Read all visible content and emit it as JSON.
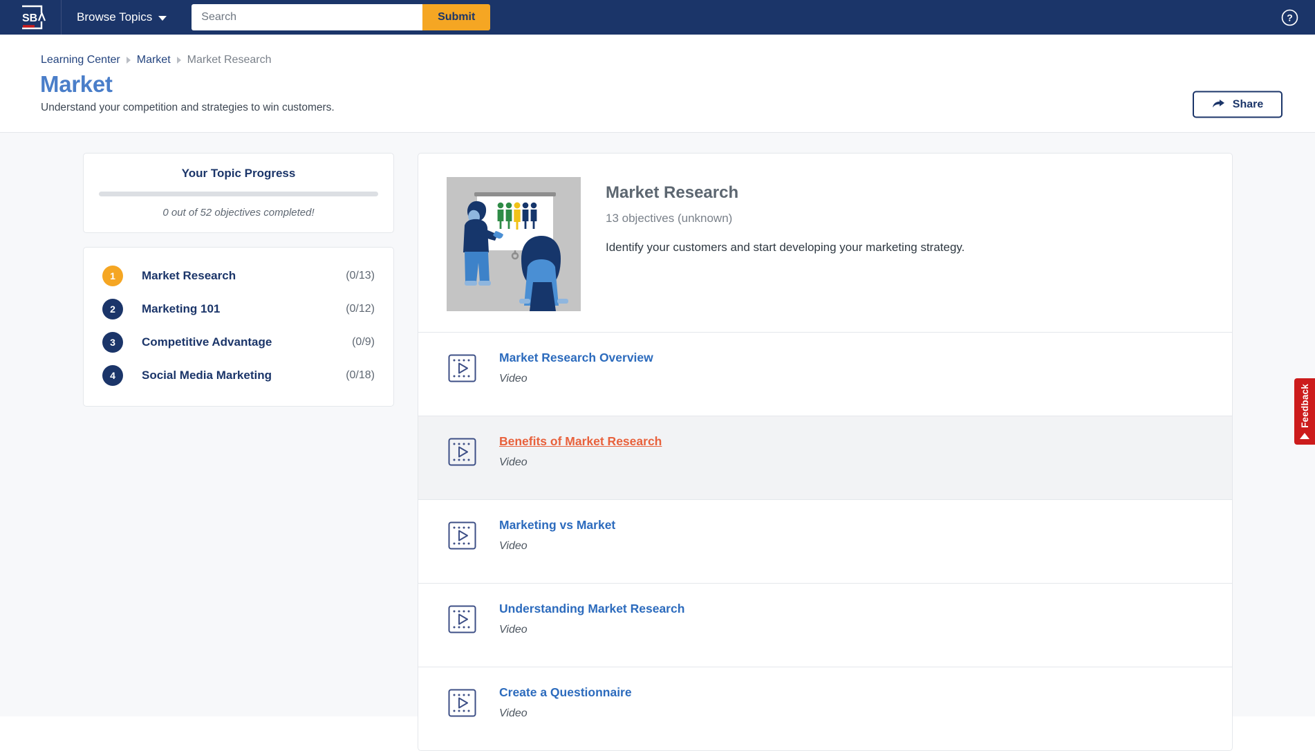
{
  "topbar": {
    "logo_text": "SBA",
    "browse_label": "Browse Topics",
    "search_placeholder": "Search",
    "search_value": "",
    "submit_label": "Submit",
    "help_icon": "question-circle-icon",
    "background_color": "#1b3569",
    "submit_color": "#f5a623"
  },
  "pagehead": {
    "breadcrumb": [
      {
        "label": "Learning Center",
        "current": false
      },
      {
        "label": "Market",
        "current": false
      },
      {
        "label": "Market Research",
        "current": true
      }
    ],
    "title": "Market",
    "subtitle": "Understand your competition and strategies to win customers.",
    "share_label": "Share",
    "share_icon": "share-arrow-icon",
    "title_color": "#4a7ec9"
  },
  "progress": {
    "title": "Your Topic Progress",
    "percent": 0,
    "note": "0 out of 52 objectives completed!",
    "completed": 0,
    "total": 52
  },
  "topics": [
    {
      "number": "1",
      "label": "Market Research",
      "count": "(0/13)",
      "active": true
    },
    {
      "number": "2",
      "label": "Marketing 101",
      "count": "(0/12)",
      "active": false
    },
    {
      "number": "3",
      "label": "Competitive Advantage",
      "count": "(0/9)",
      "active": false
    },
    {
      "number": "4",
      "label": "Social Media Marketing",
      "count": "(0/18)",
      "active": false
    }
  ],
  "lesson": {
    "thumbnail_icon": "presentation-illustration",
    "title": "Market Research",
    "objectives": "13 objectives (unknown)",
    "description": "Identify your customers and start developing your marketing strategy."
  },
  "videos": [
    {
      "title": "Market Research Overview",
      "type": "Video",
      "icon": "video-play-icon",
      "hovered": false
    },
    {
      "title": "Benefits of Market Research",
      "type": "Video",
      "icon": "video-play-icon",
      "hovered": true
    },
    {
      "title": "Marketing vs Market",
      "type": "Video",
      "icon": "video-play-icon",
      "hovered": false
    },
    {
      "title": "Understanding Market Research",
      "type": "Video",
      "icon": "video-play-icon",
      "hovered": false
    },
    {
      "title": "Create a Questionnaire",
      "type": "Video",
      "icon": "video-play-icon",
      "hovered": false
    }
  ],
  "feedback": {
    "label": "Feedback",
    "icon": "triangle-up-icon",
    "color": "#cc1c1c"
  }
}
